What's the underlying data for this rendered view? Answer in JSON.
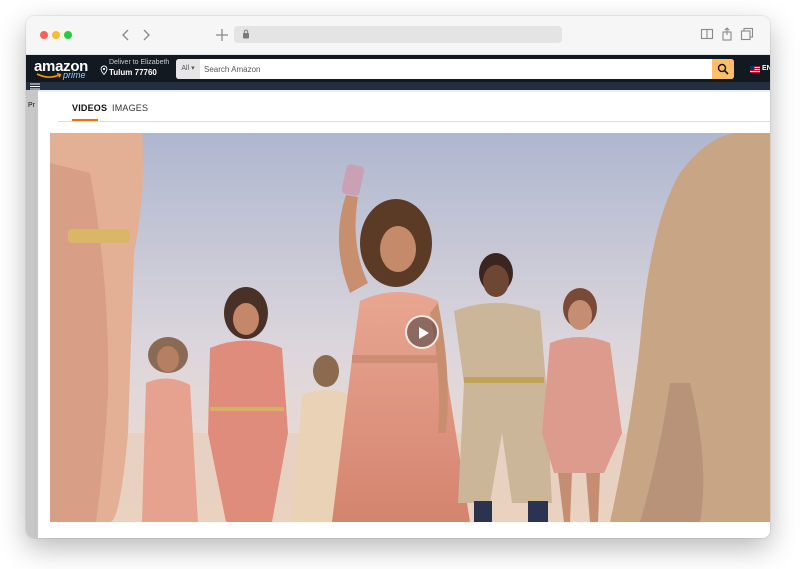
{
  "header": {
    "logo_text": "amazon",
    "logo_sub": "prime",
    "deliver_line1": "Deliver to Elizabeth",
    "deliver_line2": "Tulum 77760",
    "search_category": "All",
    "search_placeholder": "Search Amazon",
    "language": "EN"
  },
  "page": {
    "left_fragment": "Pr"
  },
  "modal": {
    "tabs": [
      {
        "label": "VIDEOS",
        "active": true
      },
      {
        "label": "IMAGES",
        "active": false
      }
    ]
  },
  "player": {
    "state": "paused",
    "control_icon": "play-icon"
  },
  "colors": {
    "amazon_header": "#131921",
    "subnav": "#232f3e",
    "search_button": "#febd69",
    "tab_accent": "#e77600"
  }
}
